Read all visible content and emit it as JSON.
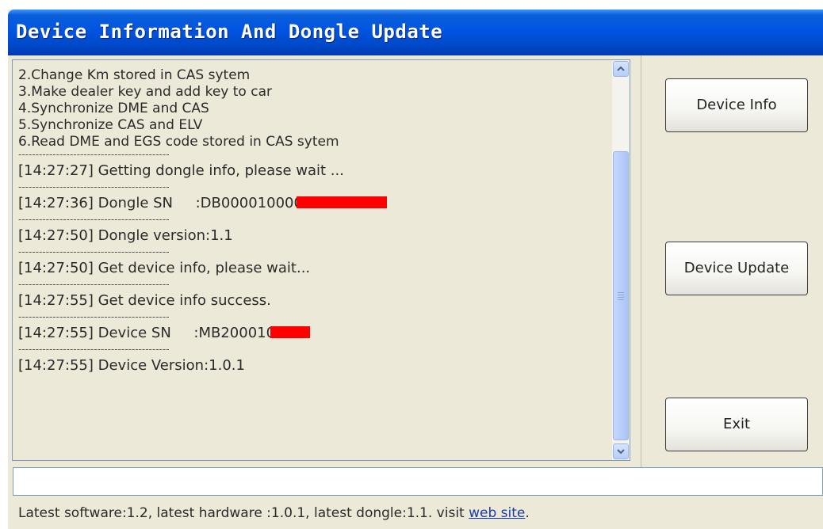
{
  "window": {
    "title": "Device Information And Dongle Update"
  },
  "log": {
    "intro_lines": [
      "2.Change Km stored in CAS sytem",
      "3.Make dealer key and add key to car",
      "4.Synchronize DME and CAS",
      "5.Synchronize CAS and ELV",
      "6.Read DME and EGS code stored in CAS sytem"
    ],
    "separator": "--------------------------------------------",
    "entries": [
      "[14:27:27] Getting dongle info, please wait ...",
      "[14:27:36] Dongle SN     :DB000010000",
      "[14:27:50] Dongle version:1.1",
      "[14:27:50] Get device info, please wait...",
      "[14:27:55] Get device info success.",
      "[14:27:55] Device SN     :MB200010",
      "[14:27:55] Device Version:1.0.1"
    ]
  },
  "buttons": {
    "device_info": "Device Info",
    "device_update": "Device Update",
    "exit": "Exit"
  },
  "input": {
    "value": ""
  },
  "status": {
    "text": "Latest software:1.2, latest hardware :1.0.1, latest dongle:1.1. visit ",
    "link": "web site",
    "suffix": "."
  },
  "icons": {
    "scroll_up": "chevron-up-icon",
    "scroll_down": "chevron-down-icon"
  },
  "colors": {
    "titlebar": "#0054e3",
    "window_bg": "#ece9d8",
    "redaction": "#ff0000",
    "link": "#1a3aa8"
  }
}
